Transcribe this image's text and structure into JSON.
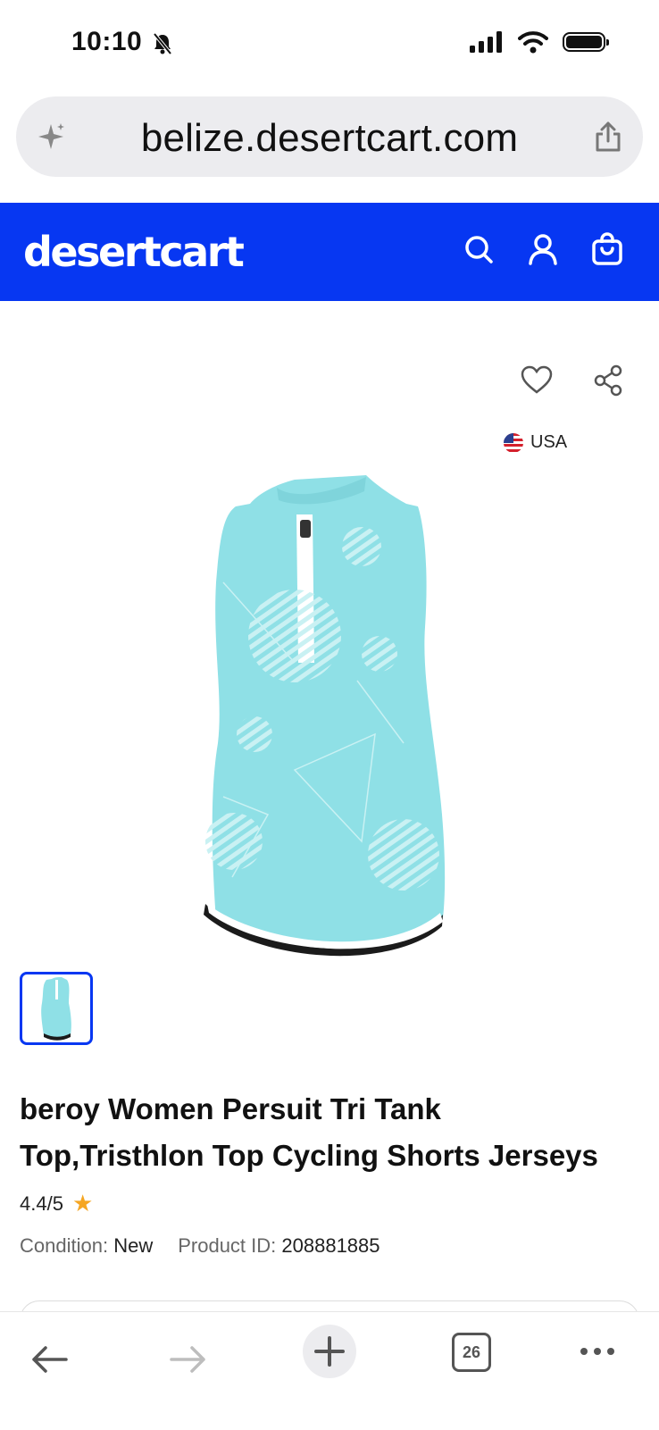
{
  "status_bar": {
    "time": "10:10"
  },
  "browser": {
    "url": "belize.desertcart.com",
    "tab_count": "26"
  },
  "site": {
    "logo": "desertcart",
    "brand_color": "#0737f2"
  },
  "product": {
    "region": "USA",
    "title_line1": "beroy Women Persuit Tri Tank",
    "title_line2": "Top,Tristhlon Top Cycling Shorts Jerseys",
    "rating": "4.4/5",
    "condition_label": "Condition:",
    "condition_value": "New",
    "product_id_label": "Product ID:",
    "product_id_value": "208881885",
    "image_color": "#8fe0e6"
  },
  "icons": {
    "status": [
      "bell-slash-icon",
      "signal-icon",
      "wifi-icon",
      "battery-icon"
    ],
    "header": [
      "search-icon",
      "user-icon",
      "cart-icon"
    ],
    "browser": [
      "sparkle-icon",
      "share-icon",
      "back-icon",
      "forward-icon",
      "plus-icon",
      "tabs-icon",
      "more-icon"
    ]
  }
}
